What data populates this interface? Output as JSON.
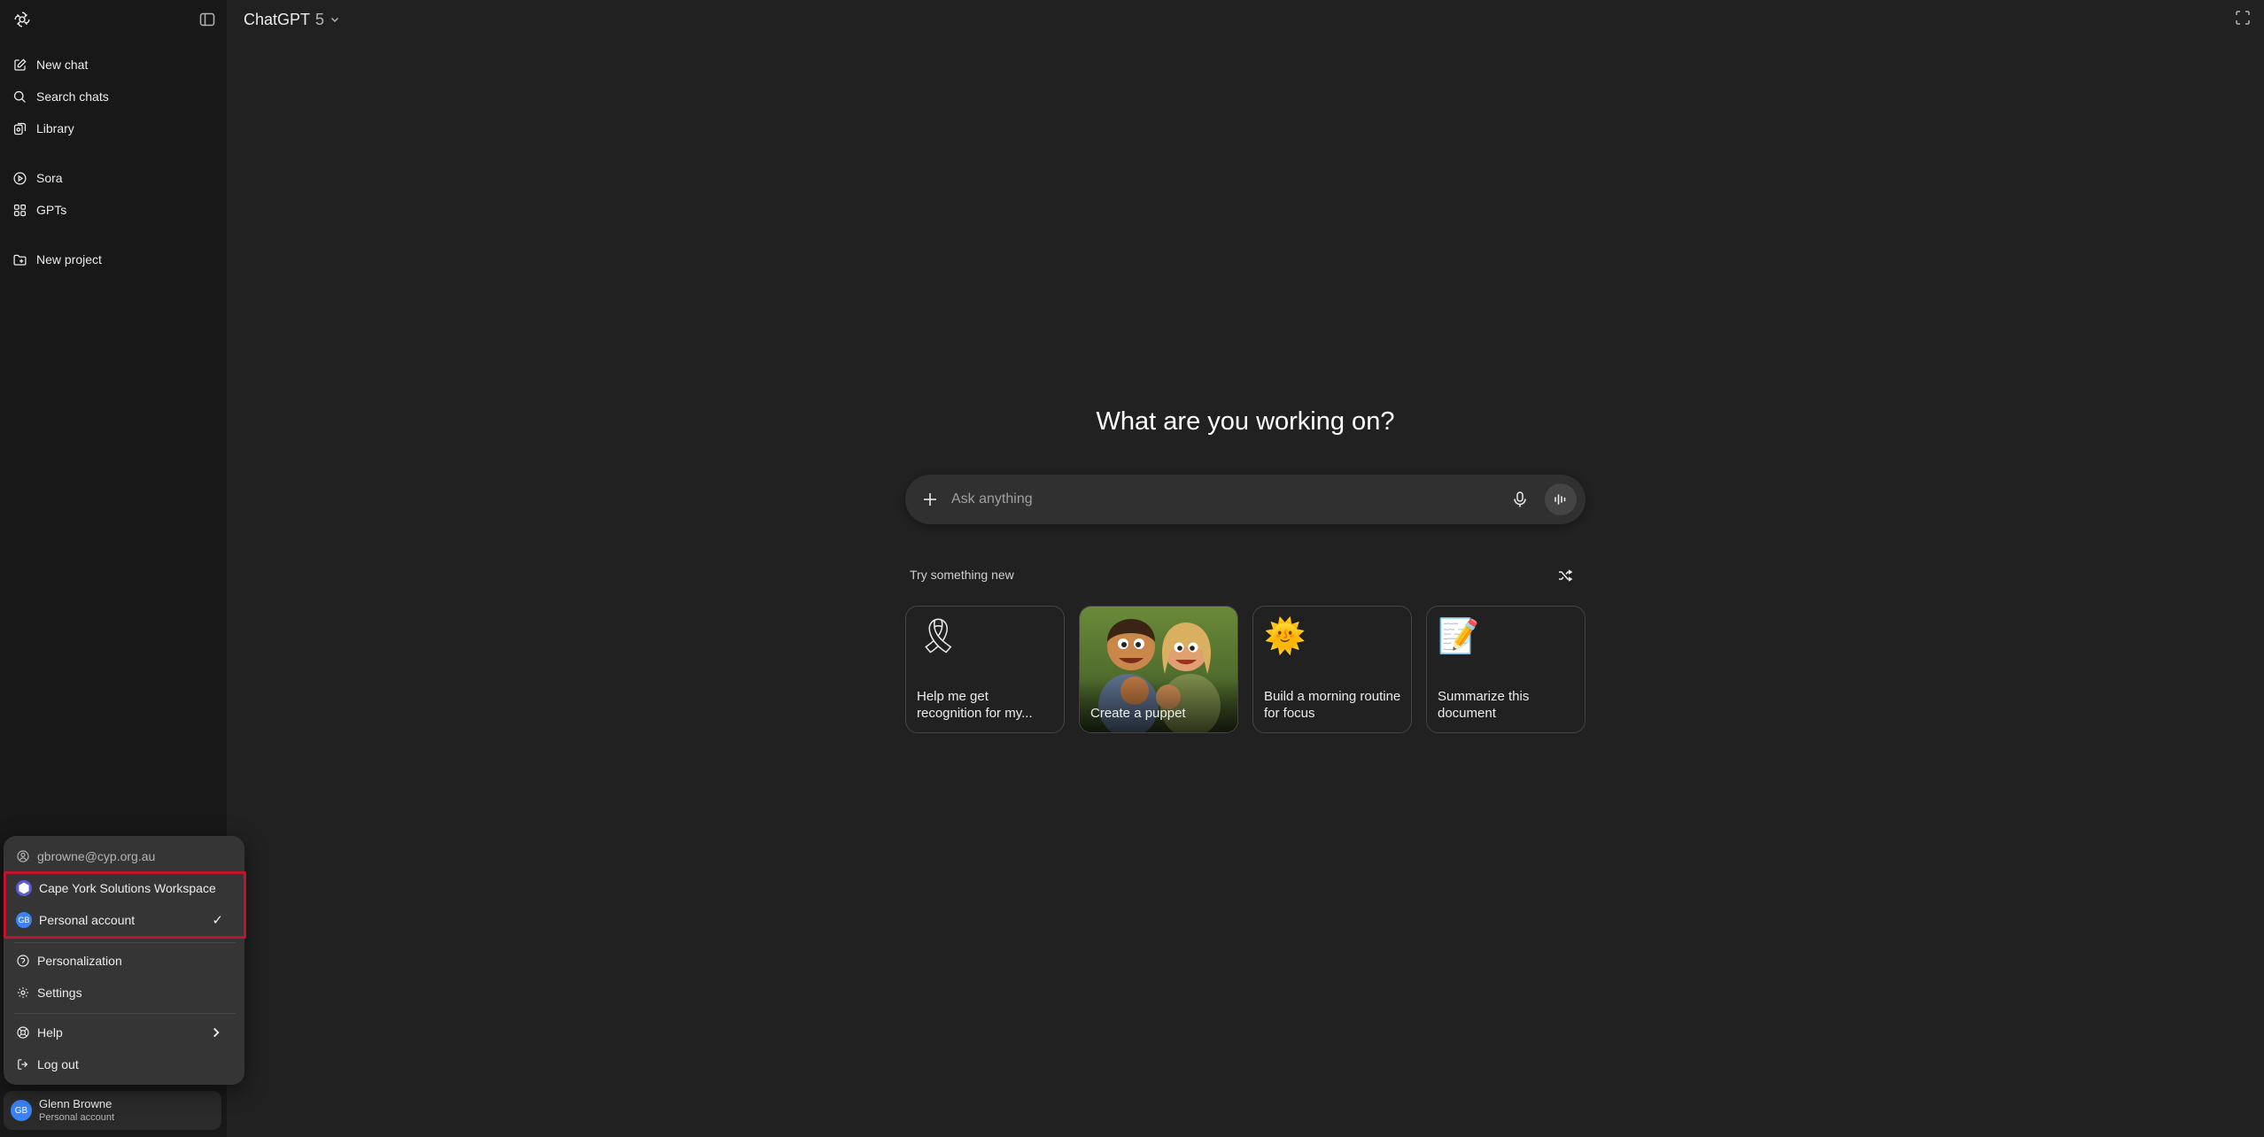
{
  "header": {
    "model_name": "ChatGPT",
    "model_version": "5"
  },
  "sidebar": {
    "items": [
      {
        "label": "New chat",
        "icon": "pencil-square-icon"
      },
      {
        "label": "Search chats",
        "icon": "search-icon"
      },
      {
        "label": "Library",
        "icon": "library-icon"
      },
      {
        "label": "Sora",
        "icon": "play-circle-icon"
      },
      {
        "label": "GPTs",
        "icon": "grid-icon"
      },
      {
        "label": "New project",
        "icon": "folder-plus-icon"
      }
    ],
    "user": {
      "initials": "GB",
      "name": "Glenn Browne",
      "plan": "Personal account"
    }
  },
  "account_menu": {
    "email": "gbrowne@cyp.org.au",
    "workspace": "Cape York Solutions Workspace",
    "personal": "Personal account",
    "personal_initials": "GB",
    "check": "✓",
    "personalization": "Personalization",
    "settings": "Settings",
    "help": "Help",
    "logout": "Log out"
  },
  "main": {
    "heading": "What are you working on?",
    "composer_placeholder": "Ask anything",
    "try_label": "Try something new",
    "cards": [
      {
        "label": "Help me get recognition for my...",
        "icon": "ribbon-medal-icon",
        "emoji": "🎗"
      },
      {
        "label": "Create a puppet",
        "icon": "puppet-family-image"
      },
      {
        "label": "Build a morning routine for focus",
        "icon": "sun-icon",
        "emoji": "🌞"
      },
      {
        "label": "Summarize this document",
        "icon": "notepad-icon",
        "emoji": "📝"
      }
    ]
  },
  "colors": {
    "background": "#212121",
    "sidebar": "#181818",
    "highlight_border": "#c0132c",
    "avatar": "#3b82f6"
  }
}
